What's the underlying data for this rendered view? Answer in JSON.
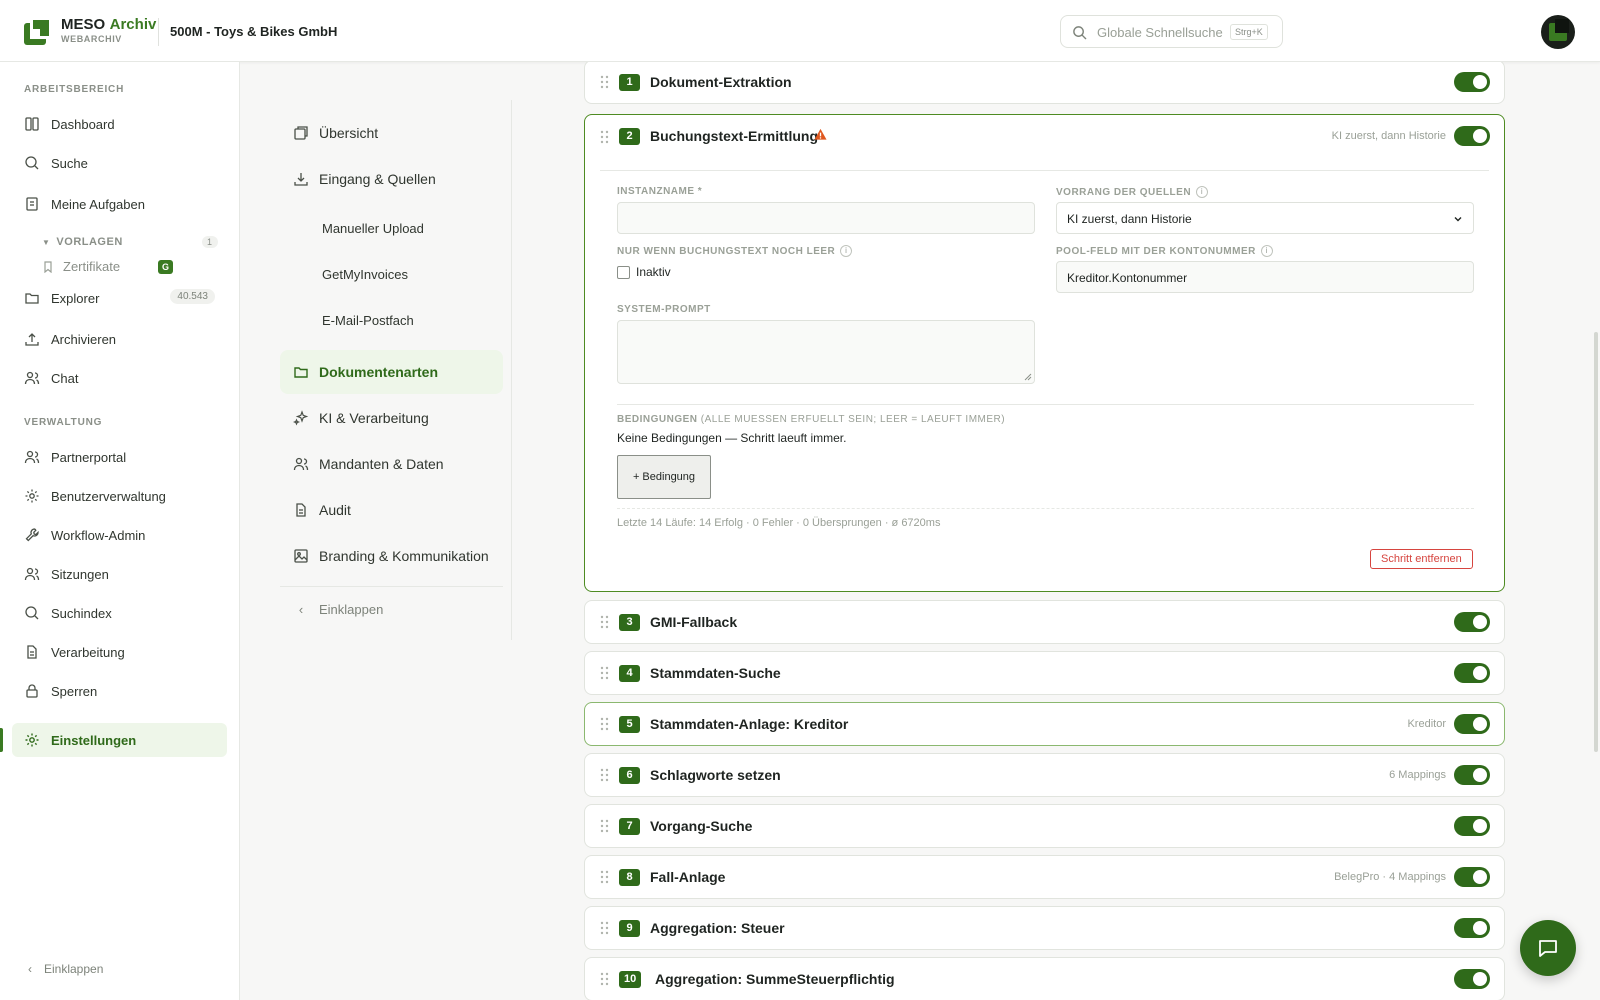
{
  "header": {
    "brand_primary": "MESO",
    "brand_secondary": "Archiv",
    "brand_sub": "WEBARCHIV",
    "tenant": "500M - Toys & Bikes GmbH",
    "search_placeholder": "Globale Schnellsuche",
    "search_shortcut": "Strg+K"
  },
  "sidebar": {
    "section_workspace": "ARBEITSBEREICH",
    "dashboard": "Dashboard",
    "search": "Suche",
    "tasks": "Meine Aufgaben",
    "templates_header": "VORLAGEN",
    "templates_count": "1",
    "certificates": "Zertifikate",
    "certificates_badge": "G",
    "explorer": "Explorer",
    "explorer_count": "40.543",
    "archive": "Archivieren",
    "chat": "Chat",
    "section_admin": "VERWALTUNG",
    "partner": "Partnerportal",
    "users": "Benutzerverwaltung",
    "workflow": "Workflow-Admin",
    "sessions": "Sitzungen",
    "index": "Suchindex",
    "processing": "Verarbeitung",
    "locks": "Sperren",
    "settings": "Einstellungen",
    "collapse": "Einklappen"
  },
  "subnav": {
    "overview": "Übersicht",
    "inputs": "Eingang & Quellen",
    "upload": "Manueller Upload",
    "gmi": "GetMyInvoices",
    "mailbox": "E-Mail-Postfach",
    "doctypes": "Dokumentenarten",
    "ai": "KI & Verarbeitung",
    "tenants": "Mandanten & Daten",
    "audit": "Audit",
    "branding": "Branding & Kommunikation",
    "collapse": "Einklappen"
  },
  "steps": [
    {
      "num": "1",
      "title": "Dokument-Extraktion",
      "meta": "",
      "enabled": true
    },
    {
      "num": "2",
      "title": "Buchungstext-Ermittlung",
      "meta": "KI zuerst, dann Historie",
      "enabled": true
    },
    {
      "num": "3",
      "title": "GMI-Fallback",
      "meta": "",
      "enabled": true
    },
    {
      "num": "4",
      "title": "Stammdaten-Suche",
      "meta": "",
      "enabled": true
    },
    {
      "num": "5",
      "title": "Stammdaten-Anlage: Kreditor",
      "meta": "Kreditor",
      "enabled": true
    },
    {
      "num": "6",
      "title": "Schlagworte setzen",
      "meta": "6 Mappings",
      "enabled": true
    },
    {
      "num": "7",
      "title": "Vorgang-Suche",
      "meta": "",
      "enabled": true
    },
    {
      "num": "8",
      "title": "Fall-Anlage",
      "meta": "BelegPro · 4 Mappings",
      "enabled": true
    },
    {
      "num": "9",
      "title": "Aggregation: Steuer",
      "meta": "",
      "enabled": true
    },
    {
      "num": "10",
      "title": "Aggregation: SummeSteuerpflichtig",
      "meta": "",
      "enabled": true
    }
  ],
  "editor": {
    "instance_label": "INSTANZNAME *",
    "instance_value": "",
    "priority_label": "VORRANG DER QUELLEN",
    "priority_value": "KI zuerst, dann Historie",
    "only_if_empty_label": "NUR WENN BUCHUNGSTEXT NOCH LEER",
    "only_if_empty_checkbox": "Inaktiv",
    "pool_field_label": "POOL-FELD MIT DER KONTONUMMER",
    "pool_field_value": "Kreditor.Kontonummer",
    "system_prompt_label": "SYSTEM-PROMPT",
    "conditions_label": "BEDINGUNGEN",
    "conditions_hint": "(ALLE MUESSEN ERFUELLT SEIN; LEER = LAEUFT IMMER)",
    "no_conditions": "Keine Bedingungen — Schritt laeuft immer.",
    "add_condition": "+ Bedingung",
    "stats": "Letzte 14 Läufe: 14 Erfolg · 0 Fehler · 0 Übersprungen · ø 6720ms",
    "remove_step": "Schritt entfernen"
  },
  "colors": {
    "accent": "#2f6a1a",
    "active_bg": "#eef6e9",
    "danger": "#d6453f",
    "warning": "#e0581f"
  }
}
